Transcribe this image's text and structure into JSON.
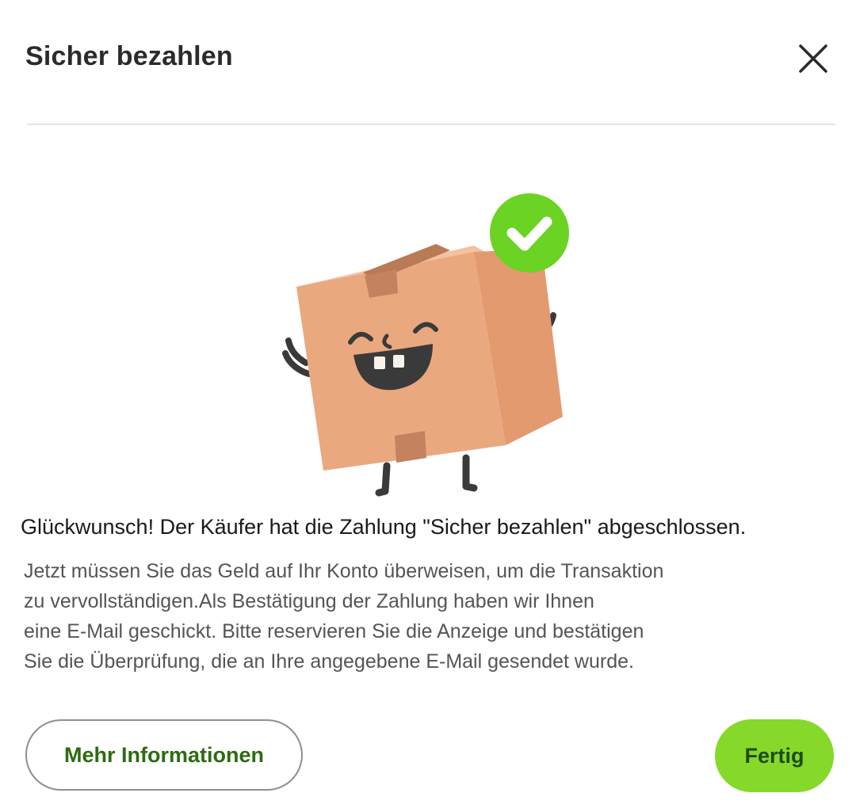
{
  "dialog": {
    "title": "Sicher bezahlen",
    "close_icon": "close-icon",
    "illustration_icons": [
      "happy-box-icon",
      "check-circle-icon"
    ],
    "colors": {
      "accent_green": "#86d82b",
      "check_badge": "#6bd323",
      "box": "#e9a97f",
      "text_dark": "#1a1a1a",
      "text_muted": "#555555"
    }
  },
  "message": {
    "headline": "Glückwunsch! Der Käufer hat die Zahlung \"Sicher bezahlen\" abgeschlossen.",
    "body_lines": [
      "Jetzt müssen Sie das Geld auf Ihr Konto überweisen, um die Transaktion",
      "zu vervollständigen.Als Bestätigung der Zahlung haben wir Ihnen",
      "eine E-Mail geschickt. Bitte reservieren Sie die Anzeige und bestätigen",
      "Sie die Überprüfung, die an Ihre angegebene E-Mail gesendet wurde."
    ]
  },
  "actions": {
    "more_label": "Mehr Informationen",
    "done_label": "Fertig"
  }
}
